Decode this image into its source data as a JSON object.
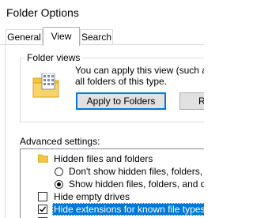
{
  "window": {
    "title": "Folder Options"
  },
  "tabs": [
    {
      "label": "General",
      "active": false
    },
    {
      "label": "View",
      "active": true
    },
    {
      "label": "Search",
      "active": false
    }
  ],
  "folder_views": {
    "group_label": "Folder views",
    "description_line1": "You can apply this view (such as D",
    "description_line2": "all folders of this type.",
    "apply_button": "Apply to Folders",
    "reset_button": "R"
  },
  "advanced": {
    "label": "Advanced settings:",
    "items": [
      {
        "type": "folder",
        "label": "Hidden files and folders"
      },
      {
        "type": "radio",
        "label": "Don't show hidden files, folders, or dr",
        "checked": false
      },
      {
        "type": "radio",
        "label": "Show hidden files, folders, and drives",
        "checked": true
      },
      {
        "type": "checkbox",
        "label": "Hide empty drives",
        "checked": false
      },
      {
        "type": "checkbox",
        "label": "Hide extensions for known file types",
        "checked": true,
        "selected": true
      }
    ]
  },
  "colors": {
    "selection": "#0078d7",
    "button_face": "#e1e1e1",
    "folder": "#f5c542"
  }
}
